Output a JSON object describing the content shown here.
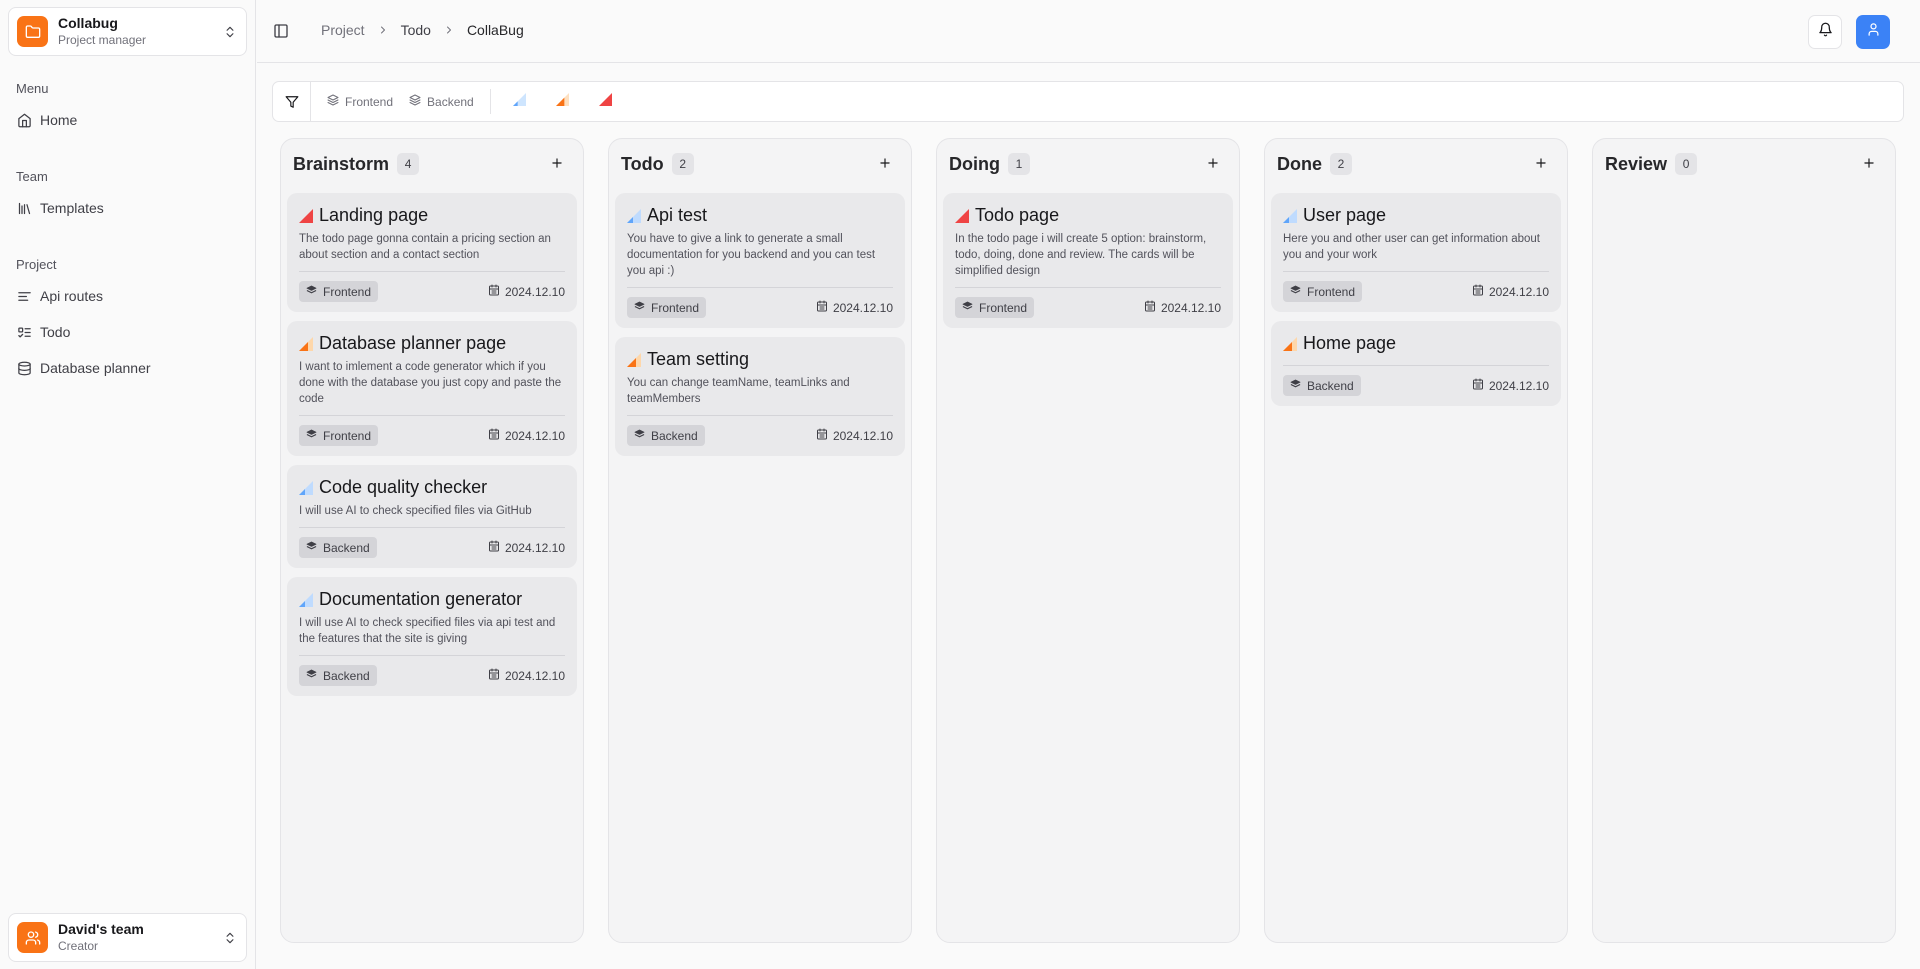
{
  "workspace": {
    "name": "Collabug",
    "role": "Project manager"
  },
  "team_switcher": {
    "name": "David's team",
    "role": "Creator"
  },
  "sidebar": {
    "groups": [
      {
        "label": "Menu",
        "items": [
          {
            "label": "Home",
            "icon": "home-icon"
          }
        ]
      },
      {
        "label": "Team",
        "items": [
          {
            "label": "Templates",
            "icon": "library-icon"
          }
        ]
      },
      {
        "label": "Project",
        "items": [
          {
            "label": "Api routes",
            "icon": "text-align-icon"
          },
          {
            "label": "Todo",
            "icon": "list-todo-icon"
          },
          {
            "label": "Database planner",
            "icon": "database-icon"
          }
        ]
      }
    ]
  },
  "breadcrumb": [
    "Project",
    "Todo",
    "CollaBug"
  ],
  "filters": {
    "tags": [
      "Frontend",
      "Backend"
    ],
    "priorities": [
      "low",
      "medium",
      "high"
    ]
  },
  "colors": {
    "accent": "#f97316",
    "user": "#3b82f6",
    "priority_low": "#93c5fd",
    "priority_medium": "#fb923c",
    "priority_high": "#ef4444"
  },
  "columns": [
    {
      "title": "Brainstorm",
      "count": "4",
      "cards": [
        {
          "title": "Landing page",
          "priority": "high",
          "desc": "The todo page gonna contain a pricing section an about section and a contact section",
          "tag": "Frontend",
          "date": "2024.12.10"
        },
        {
          "title": "Database planner page",
          "priority": "medium",
          "desc": "I want to imlement a code generator which if you done with the database you just copy and paste the code",
          "tag": "Frontend",
          "date": "2024.12.10"
        },
        {
          "title": "Code quality checker",
          "priority": "low",
          "desc": "I will use AI to check specified files via GitHub",
          "tag": "Backend",
          "date": "2024.12.10"
        },
        {
          "title": "Documentation generator",
          "priority": "low",
          "desc": "I will use AI to check specified files via api test and the features that the site is giving",
          "tag": "Backend",
          "date": "2024.12.10"
        }
      ]
    },
    {
      "title": "Todo",
      "count": "2",
      "cards": [
        {
          "title": "Api test",
          "priority": "low",
          "desc": "You have to give a link to generate a small documentation for you backend and you can test you api :)",
          "tag": "Frontend",
          "date": "2024.12.10"
        },
        {
          "title": "Team setting",
          "priority": "medium",
          "desc": "You can change teamName, teamLinks and teamMembers",
          "tag": "Backend",
          "date": "2024.12.10"
        }
      ]
    },
    {
      "title": "Doing",
      "count": "1",
      "cards": [
        {
          "title": "Todo page",
          "priority": "high",
          "desc": "In the todo page i will create 5 option: brainstorm, todo, doing, done and review. The cards will be simplified design",
          "tag": "Frontend",
          "date": "2024.12.10"
        }
      ]
    },
    {
      "title": "Done",
      "count": "2",
      "cards": [
        {
          "title": "User page",
          "priority": "low",
          "desc": "Here you and other user can get information about you and your work",
          "tag": "Frontend",
          "date": "2024.12.10"
        },
        {
          "title": "Home page",
          "priority": "medium",
          "desc": "",
          "tag": "Backend",
          "date": "2024.12.10"
        }
      ]
    },
    {
      "title": "Review",
      "count": "0",
      "cards": []
    }
  ]
}
